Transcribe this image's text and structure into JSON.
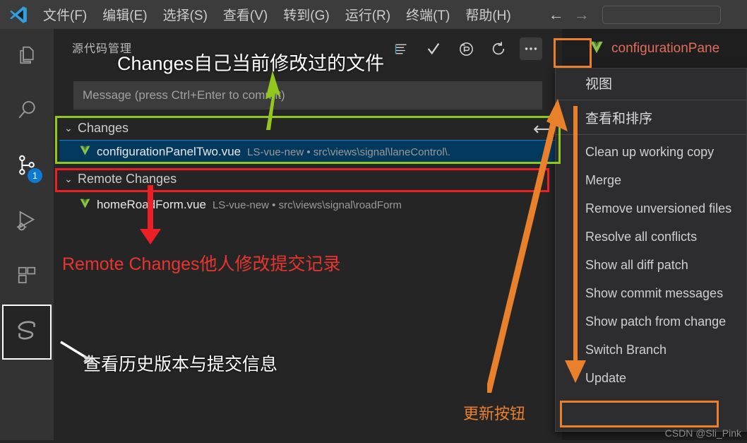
{
  "window": {
    "app": "Visual Studio Code",
    "menu": [
      {
        "label": "文件(F)",
        "name": "menu-file"
      },
      {
        "label": "编辑(E)",
        "name": "menu-edit"
      },
      {
        "label": "选择(S)",
        "name": "menu-selection"
      },
      {
        "label": "查看(V)",
        "name": "menu-view"
      },
      {
        "label": "转到(G)",
        "name": "menu-go"
      },
      {
        "label": "运行(R)",
        "name": "menu-run"
      },
      {
        "label": "终端(T)",
        "name": "menu-terminal"
      },
      {
        "label": "帮助(H)",
        "name": "menu-help"
      }
    ],
    "nav_back": "←",
    "nav_forward": "→",
    "search_placeholder": ""
  },
  "activity_bar": {
    "items": [
      {
        "icon": "explorer-icon",
        "label": "资源管理器"
      },
      {
        "icon": "search-icon",
        "label": "搜索"
      },
      {
        "icon": "source-control-icon",
        "label": "源代码管理",
        "badge": "1"
      },
      {
        "icon": "run-debug-icon",
        "label": "运行和调试"
      },
      {
        "icon": "extensions-icon",
        "label": "扩展"
      },
      {
        "icon": "svn-icon",
        "label": "SVN",
        "selected": true
      }
    ],
    "source_control_badge": "1"
  },
  "scm": {
    "title": "源代码管理",
    "toolbar": [
      {
        "name": "view-as-list-icon",
        "label": "视图"
      },
      {
        "name": "commit-check-icon",
        "label": "提交"
      },
      {
        "name": "revert-icon",
        "label": "还原"
      },
      {
        "name": "refresh-icon",
        "label": "刷新"
      },
      {
        "name": "more-actions-icon",
        "label": "..."
      }
    ],
    "commit_placeholder": "Message (press Ctrl+Enter to commit)",
    "commit_value": "",
    "sections": [
      {
        "label": "Changes",
        "chevron": "⌄",
        "files": [
          {
            "name": "configurationPanelTwo.vue",
            "meta": "LS-vue-new • src\\views\\signal\\laneControl\\.",
            "selected": true
          }
        ]
      },
      {
        "label": "Remote Changes",
        "chevron": "⌄",
        "files": [
          {
            "name": "homeRoadForm.vue",
            "meta": "LS-vue-new • src\\views\\signal\\roadForm",
            "selected": false
          }
        ]
      }
    ]
  },
  "editor": {
    "tab_label": "configurationPane",
    "tab_icon": "vue-icon"
  },
  "context_menu": {
    "items": [
      {
        "label": "视图",
        "cn": true,
        "sep_after": true
      },
      {
        "label": "查看和排序",
        "cn": true,
        "sep_after": true
      },
      {
        "label": "Clean up working copy",
        "cn": false
      },
      {
        "label": "Merge",
        "cn": false
      },
      {
        "label": "Remove unversioned files",
        "cn": false
      },
      {
        "label": "Resolve all conflicts",
        "cn": false
      },
      {
        "label": "Show all diff patch",
        "cn": false
      },
      {
        "label": "Show commit messages",
        "cn": false
      },
      {
        "label": "Show patch from change",
        "cn": false
      },
      {
        "label": "Switch Branch",
        "cn": false
      },
      {
        "label": "Update",
        "cn": false,
        "highlighted": true
      }
    ]
  },
  "annotations": {
    "changes_note": "Changes自己当前修改过的文件",
    "remote_note": "Remote Changes他人修改提交记录",
    "history_note": "查看历史版本与提交信息",
    "update_note": "更新按钮",
    "colors": {
      "green": "#92c71f",
      "red": "#ec2024",
      "orange": "#e8802c",
      "white": "#ffffff"
    }
  },
  "watermark": "CSDN @Sli_Pink"
}
